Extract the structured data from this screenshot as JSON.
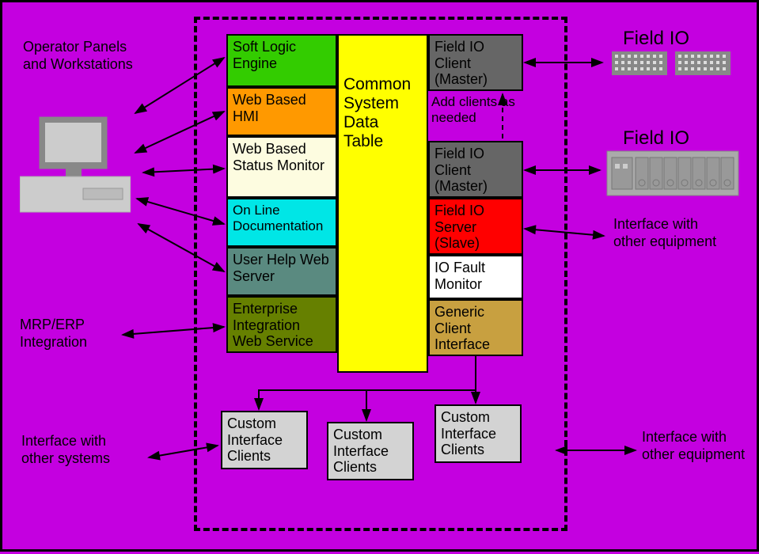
{
  "left_labels": {
    "operator": "Operator Panels and Workstations",
    "mrp": "MRP/ERP Integration",
    "interface_systems": "Interface with other systems"
  },
  "right_labels": {
    "field_io_1": "Field IO",
    "field_io_2": "Field IO",
    "interface_equipment_upper": "Interface with other equipment",
    "interface_equipment_lower": "Interface with other equipment"
  },
  "center": {
    "data_table": "Common System Data Table",
    "soft_logic": "Soft Logic Engine",
    "web_hmi": "Web Based HMI",
    "web_status": "Web Based Status Monitor",
    "online_doc": "On Line Documentation",
    "user_help": "User Help Web Server",
    "eiws": "Enterprise Integration Web Service",
    "fio_client1": "Field IO Client (Master)",
    "add_clients": "Add clients as needed",
    "fio_client2": "Field IO Client (Master)",
    "fio_server": "Field IO Server (Slave)",
    "io_fault": "IO Fault Monitor",
    "generic_client": "Generic Client Interface",
    "custom1": "Custom Interface Clients",
    "custom2": "Custom Interface Clients",
    "custom3": "Custom Interface Clients"
  }
}
